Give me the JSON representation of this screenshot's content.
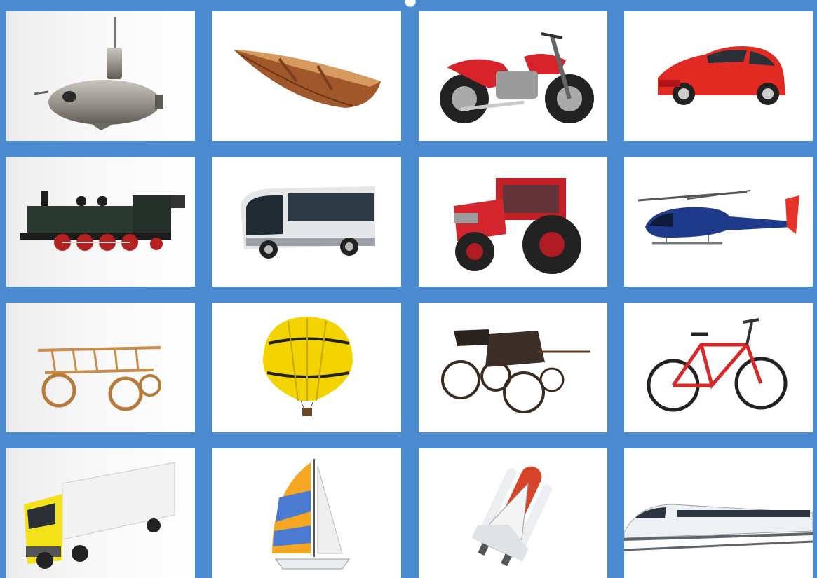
{
  "board": {
    "rows": 4,
    "columns": 4,
    "frame_color": "#4d8bd0"
  },
  "tiles": [
    {
      "icon": "submarine-icon"
    },
    {
      "icon": "rowboat-icon"
    },
    {
      "icon": "motorcycle-icon"
    },
    {
      "icon": "car-icon"
    },
    {
      "icon": "steam-locomotive-icon"
    },
    {
      "icon": "bus-icon"
    },
    {
      "icon": "tractor-icon"
    },
    {
      "icon": "helicopter-icon"
    },
    {
      "icon": "wooden-wagon-icon"
    },
    {
      "icon": "hot-air-balloon-icon"
    },
    {
      "icon": "horse-carriage-icon"
    },
    {
      "icon": "bicycle-icon"
    },
    {
      "icon": "semi-truck-icon"
    },
    {
      "icon": "sailboat-icon"
    },
    {
      "icon": "space-shuttle-icon"
    },
    {
      "icon": "bullet-train-icon"
    }
  ]
}
